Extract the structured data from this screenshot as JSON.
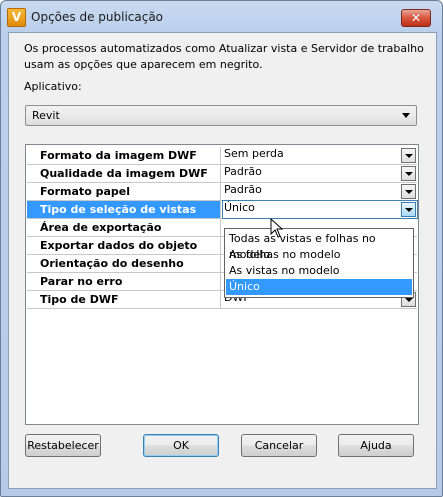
{
  "window": {
    "title": "Opções de publicação",
    "app_icon_glyph": "V",
    "close_glyph": "✕"
  },
  "description": "Os processos automatizados como Atualizar vista e Servidor de trabalho usam as opções que aparecem em negrito.",
  "application": {
    "label": "Aplicativo:",
    "value": "Revit"
  },
  "properties": [
    {
      "name": "Formato da imagem DWF",
      "value": "Sem perda"
    },
    {
      "name": "Qualidade da imagem DWF",
      "value": "Padrão"
    },
    {
      "name": "Formato papel",
      "value": "Padrão"
    },
    {
      "name": "Tipo de seleção de vistas",
      "value": "Único"
    },
    {
      "name": "Área de exportação",
      "value": ""
    },
    {
      "name": "Exportar dados do objeto",
      "value": ""
    },
    {
      "name": "Orientação do desenho",
      "value": ""
    },
    {
      "name": "Parar no erro",
      "value": ""
    },
    {
      "name": "Tipo de DWF",
      "value": "DWF"
    }
  ],
  "dropdown_options": [
    "Todas as vistas e folhas no modelo",
    "As folhas no modelo",
    "As vistas no modelo",
    "Único"
  ],
  "buttons": {
    "reset": "Restabelecer",
    "ok": "OK",
    "cancel": "Cancelar",
    "help": "Ajuda"
  }
}
